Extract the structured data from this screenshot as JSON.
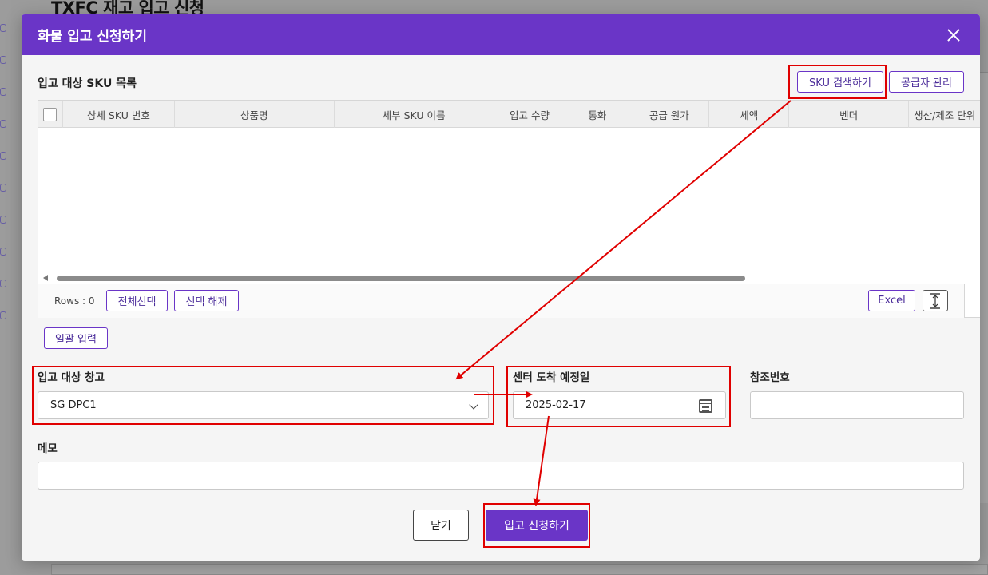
{
  "background": {
    "page_title": "TXFC 재고 입고 신청"
  },
  "modal": {
    "title": "화물 입고 신청하기",
    "sku_section_title": "입고 대상 SKU 목록",
    "buttons": {
      "sku_search": "SKU 검색하기",
      "supplier_manage": "공급자 관리",
      "select_all": "전체선택",
      "deselect": "선택 해제",
      "excel": "Excel",
      "bulk_input": "일괄 입력",
      "close": "닫기",
      "submit": "입고 신청하기"
    },
    "grid": {
      "columns": [
        "상세 SKU 번호",
        "상품명",
        "세부 SKU 이름",
        "입고 수량",
        "통화",
        "공급 원가",
        "세액",
        "벤더",
        "생산/제조 단위"
      ],
      "rows_label": "Rows : 0"
    },
    "form": {
      "warehouse_label": "입고 대상 창고",
      "warehouse_value": "SG DPC1",
      "arrival_label": "센터 도착 예정일",
      "arrival_value": "2025-02-17",
      "reference_label": "참조번호",
      "reference_value": "",
      "memo_label": "메모",
      "memo_value": ""
    }
  },
  "colors": {
    "header": "#6a35c7",
    "annotation": "#e00000"
  },
  "icons": [
    "close-icon",
    "chevron-down-icon",
    "calendar-icon",
    "row-height-icon",
    "scroll-left-icon"
  ]
}
